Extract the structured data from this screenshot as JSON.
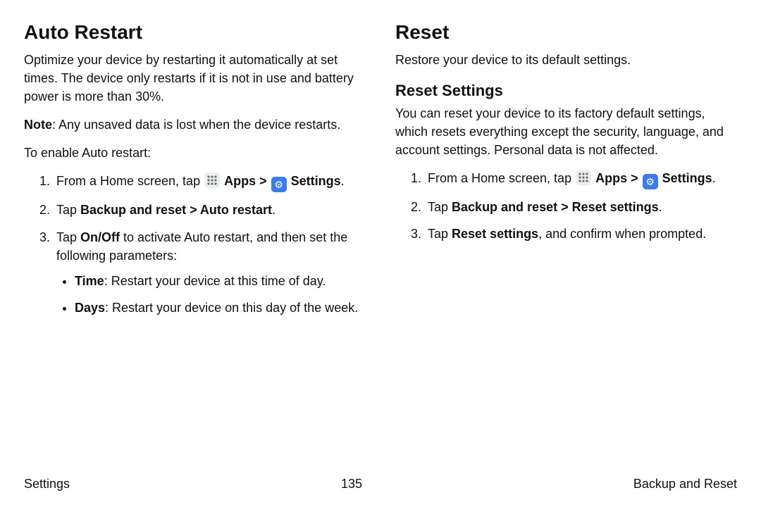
{
  "left": {
    "title": "Auto Restart",
    "intro": "Optimize your device by restarting it automatically at set times. The device only restarts if it is not in use and battery power is more than 30%.",
    "note_label": "Note",
    "note_body": ": Any unsaved data is lost when the device restarts.",
    "enable_line": "To enable Auto restart:",
    "step1_pre": "From a Home screen, tap ",
    "apps_label": "Apps",
    "chevron": " > ",
    "settings_label": "Settings",
    "step1_post": ".",
    "step2_pre": "Tap ",
    "step2_bold": "Backup and reset > Auto restart",
    "step2_post": ".",
    "step3_a": "Tap ",
    "step3_b": "On/Off",
    "step3_c": " to activate Auto restart, and then set the following parameters:",
    "bullet1_label": "Time",
    "bullet1_body": ": Restart your device at this time of day.",
    "bullet2_label": "Days",
    "bullet2_body": ": Restart your device on this day of the week."
  },
  "right": {
    "title": "Reset",
    "intro": "Restore your device to its default settings.",
    "sub": "Reset Settings",
    "sub_intro": "You can reset your device to its factory default settings, which resets everything except the security, language, and account settings. Personal data is not affected.",
    "step1_pre": "From a Home screen, tap ",
    "apps_label": "Apps",
    "chevron": " > ",
    "settings_label": "Settings",
    "step1_post": ".",
    "step2_pre": "Tap ",
    "step2_bold": "Backup and reset > Reset settings",
    "step2_post": ".",
    "step3_a": "Tap ",
    "step3_b": "Reset settings",
    "step3_c": ", and confirm when prompted."
  },
  "footer": {
    "left": "Settings",
    "center": "135",
    "right": "Backup and Reset"
  }
}
